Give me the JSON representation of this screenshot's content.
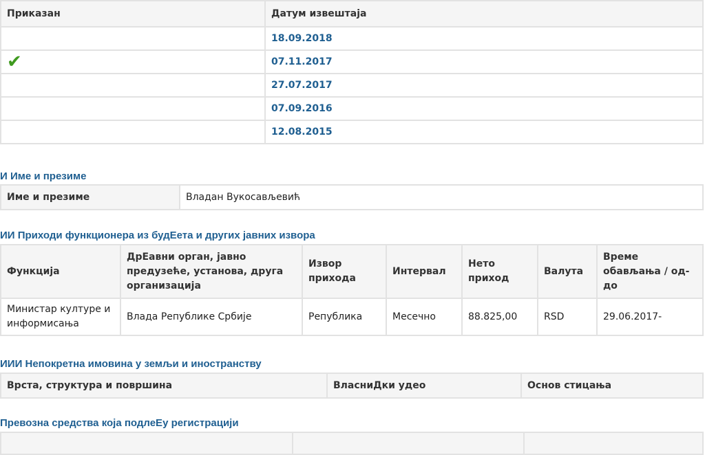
{
  "reports": {
    "headers": {
      "shown": "Приказан",
      "date": "Датум извештаја"
    },
    "rows": [
      {
        "shown": false,
        "date": "18.09.2018"
      },
      {
        "shown": true,
        "date": "07.11.2017"
      },
      {
        "shown": false,
        "date": "27.07.2017"
      },
      {
        "shown": false,
        "date": "07.09.2016"
      },
      {
        "shown": false,
        "date": "12.08.2015"
      }
    ],
    "check_icon": "checkmark-icon",
    "check_color": "#3f9a1f"
  },
  "section1": {
    "title": "И Име и презиме",
    "label": "Име и презиме",
    "value": "Владан Вукосављевић"
  },
  "section2": {
    "title": "ИИ Приходи функционера из будЕета и других јавних извора",
    "headers": [
      "Функција",
      "ДрЕавни орган, јавно предузеће, установа, друга организација",
      "Извор прихода",
      "Интервал",
      "Нето приход",
      "Валута",
      "Време обављања / од-до"
    ],
    "row": [
      "Министар културе и информисања",
      "Влада Републике Србије",
      "Република",
      "Месечно",
      "88.825,00",
      "RSD",
      "29.06.2017-"
    ]
  },
  "section3": {
    "title": "ИИИ Непокретна имовина у земљи и иностранству",
    "headers": [
      "Врста, структура и површина",
      "ВласниДки удео",
      "Основ стицања"
    ]
  },
  "section4": {
    "title": "Превозна средства која подлеЕу регистрацији"
  },
  "colors": {
    "accent": "#1f5f91",
    "header_bg": "#f5f5f5",
    "border": "#e2e2e2"
  }
}
